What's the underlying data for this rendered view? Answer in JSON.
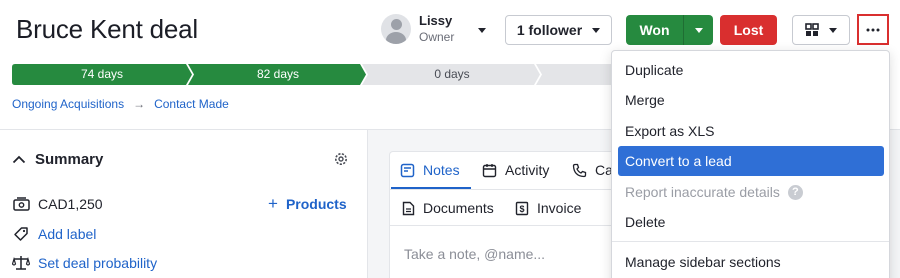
{
  "deal": {
    "title": "Bruce Kent deal"
  },
  "owner": {
    "name": "Lissy",
    "role": "Owner"
  },
  "follower": {
    "label": "1 follower"
  },
  "actions": {
    "won_label": "Won",
    "lost_label": "Lost"
  },
  "pipeline": {
    "stages": [
      {
        "label": "74 days",
        "state": "done"
      },
      {
        "label": "82 days",
        "state": "current"
      },
      {
        "label": "0 days",
        "state": "pending"
      },
      {
        "label": "",
        "state": "pending"
      }
    ]
  },
  "breadcrumb": {
    "items": [
      "Ongoing Acquisitions",
      "Contact Made"
    ],
    "separator": "→"
  },
  "summary": {
    "title": "Summary",
    "value": "CAD1,250",
    "products_label": "Products",
    "add_label": "Add label",
    "deal_probability": "Set deal probability"
  },
  "tabs": {
    "notes": "Notes",
    "activity": "Activity",
    "call": "Ca",
    "documents": "Documents",
    "invoice": "Invoice"
  },
  "note": {
    "placeholder": "Take a note, @name..."
  },
  "menu": {
    "items": [
      {
        "label": "Duplicate"
      },
      {
        "label": "Merge"
      },
      {
        "label": "Export as XLS"
      },
      {
        "label": "Convert to a lead"
      },
      {
        "label": "Report inaccurate details"
      },
      {
        "label": "Delete"
      },
      {
        "label": "Manage sidebar sections"
      }
    ]
  },
  "colors": {
    "won": "#268a3f",
    "lost": "#d92f2f",
    "link": "#1f63c9",
    "menu_active": "#2f6fd6",
    "stage_done": "#268a3f",
    "stage_pending": "#e4e5e8"
  }
}
